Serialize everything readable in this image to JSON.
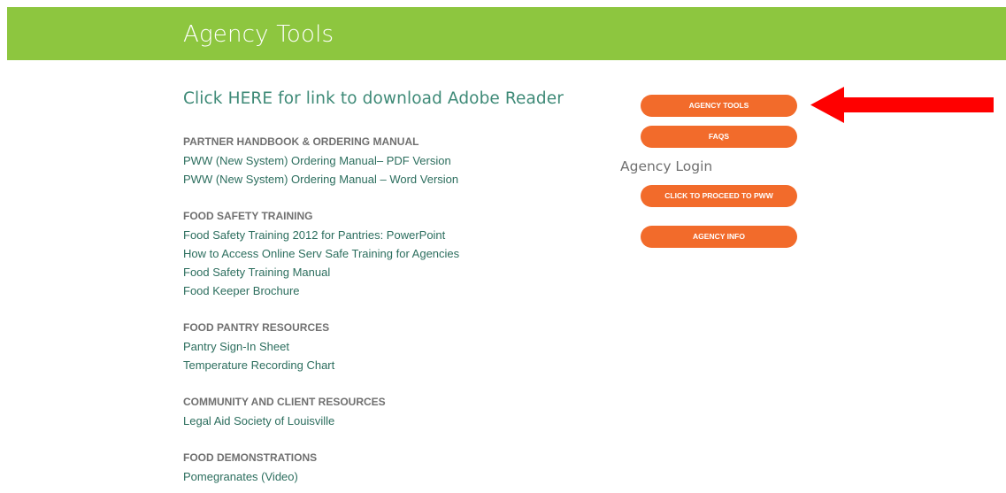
{
  "banner": {
    "title": "Agency Tools"
  },
  "main": {
    "reader_link": "Click HERE for link to download Adobe Reader",
    "sections": [
      {
        "heading": "PARTNER HANDBOOK & ORDERING MANUAL",
        "links": [
          "PWW (New System) Ordering Manual– PDF Version",
          "PWW (New System) Ordering Manual – Word Version"
        ]
      },
      {
        "heading": "FOOD SAFETY TRAINING",
        "links": [
          "Food Safety Training 2012 for Pantries: PowerPoint",
          "How to Access Online Serv Safe Training for Agencies",
          "Food Safety Training Manual",
          "Food Keeper Brochure"
        ]
      },
      {
        "heading": "FOOD PANTRY RESOURCES",
        "links": [
          "Pantry Sign-In Sheet",
          "Temperature Recording Chart"
        ]
      },
      {
        "heading": "COMMUNITY AND CLIENT RESOURCES",
        "links": [
          "Legal Aid Society of Louisville"
        ]
      },
      {
        "heading": "FOOD DEMONSTRATIONS",
        "links": [
          "Pomegranates (Video)"
        ]
      }
    ]
  },
  "sidebar": {
    "agency_tools_button": "AGENCY TOOLS",
    "faqs_button": "FAQS",
    "login_heading": "Agency Login",
    "proceed_button": "CLICK TO PROCEED TO PWW",
    "agency_info_button": "AGENCY INFO"
  },
  "colors": {
    "banner_green": "#8dc63f",
    "button_orange": "#f26b2b",
    "link_teal": "#2c6e5e",
    "arrow_red": "#ff0000"
  },
  "icons": {
    "annotation": "red-arrow-left-icon"
  }
}
